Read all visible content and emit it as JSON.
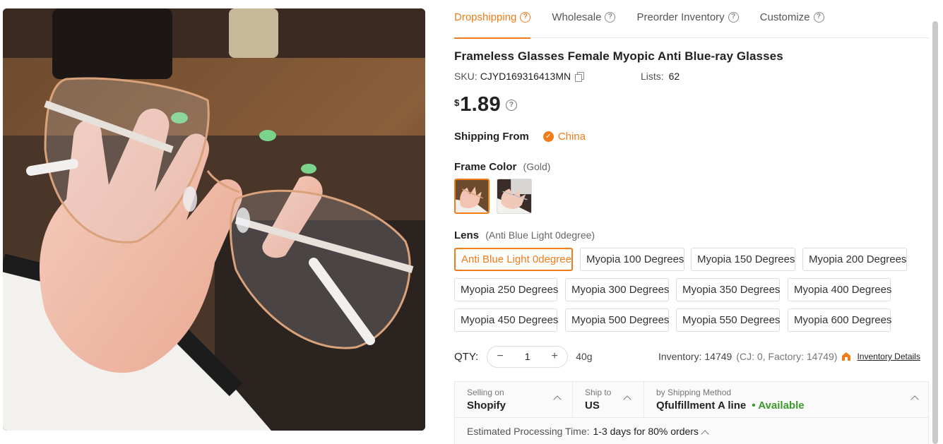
{
  "tabs": [
    {
      "label": "Dropshipping",
      "active": true
    },
    {
      "label": "Wholesale",
      "active": false
    },
    {
      "label": "Preorder Inventory",
      "active": false
    },
    {
      "label": "Customize",
      "active": false
    }
  ],
  "product": {
    "title": "Frameless Glasses Female Myopic Anti Blue-ray Glasses",
    "sku_label": "SKU:",
    "sku": "CJYD169316413MN",
    "lists_label": "Lists:",
    "lists": "62",
    "currency": "$",
    "price": "1.89"
  },
  "shipping_from": {
    "label": "Shipping From",
    "value": "China"
  },
  "frame_color": {
    "label": "Frame Color",
    "selected": "(Gold)"
  },
  "lens": {
    "label": "Lens",
    "selected": "(Anti Blue Light 0degree)",
    "options": [
      "Anti Blue Light 0degree",
      "Myopia 100 Degrees",
      "Myopia 150 Degrees",
      "Myopia 200 Degrees",
      "Myopia 250 Degrees",
      "Myopia 300 Degrees",
      "Myopia 350 Degrees",
      "Myopia 400 Degrees",
      "Myopia 450 Degrees",
      "Myopia 500 Degrees",
      "Myopia 550 Degrees",
      "Myopia 600 Degrees"
    ]
  },
  "qty": {
    "label": "QTY:",
    "minus": "−",
    "value": "1",
    "plus": "+",
    "weight": "40g"
  },
  "inventory": {
    "text": "Inventory: 14749",
    "detail": "(CJ: 0, Factory: 14749)",
    "link": "Inventory Details"
  },
  "shipping": {
    "selling_on_label": "Selling on",
    "selling_on": "Shopify",
    "ship_to_label": "Ship to",
    "ship_to": "US",
    "method_label": "by Shipping Method",
    "method": "Qfulfillment A line",
    "availability": "• Available",
    "processing_label": "Estimated Processing Time:",
    "processing_value": "1-3 days for 80% orders"
  },
  "colors": {
    "accent": "#f07c1a",
    "available": "#3a9a2a"
  },
  "icons": [
    "help-circle-icon",
    "copy-icon",
    "check-circle-icon",
    "warehouse-icon",
    "chevron-up-icon"
  ]
}
